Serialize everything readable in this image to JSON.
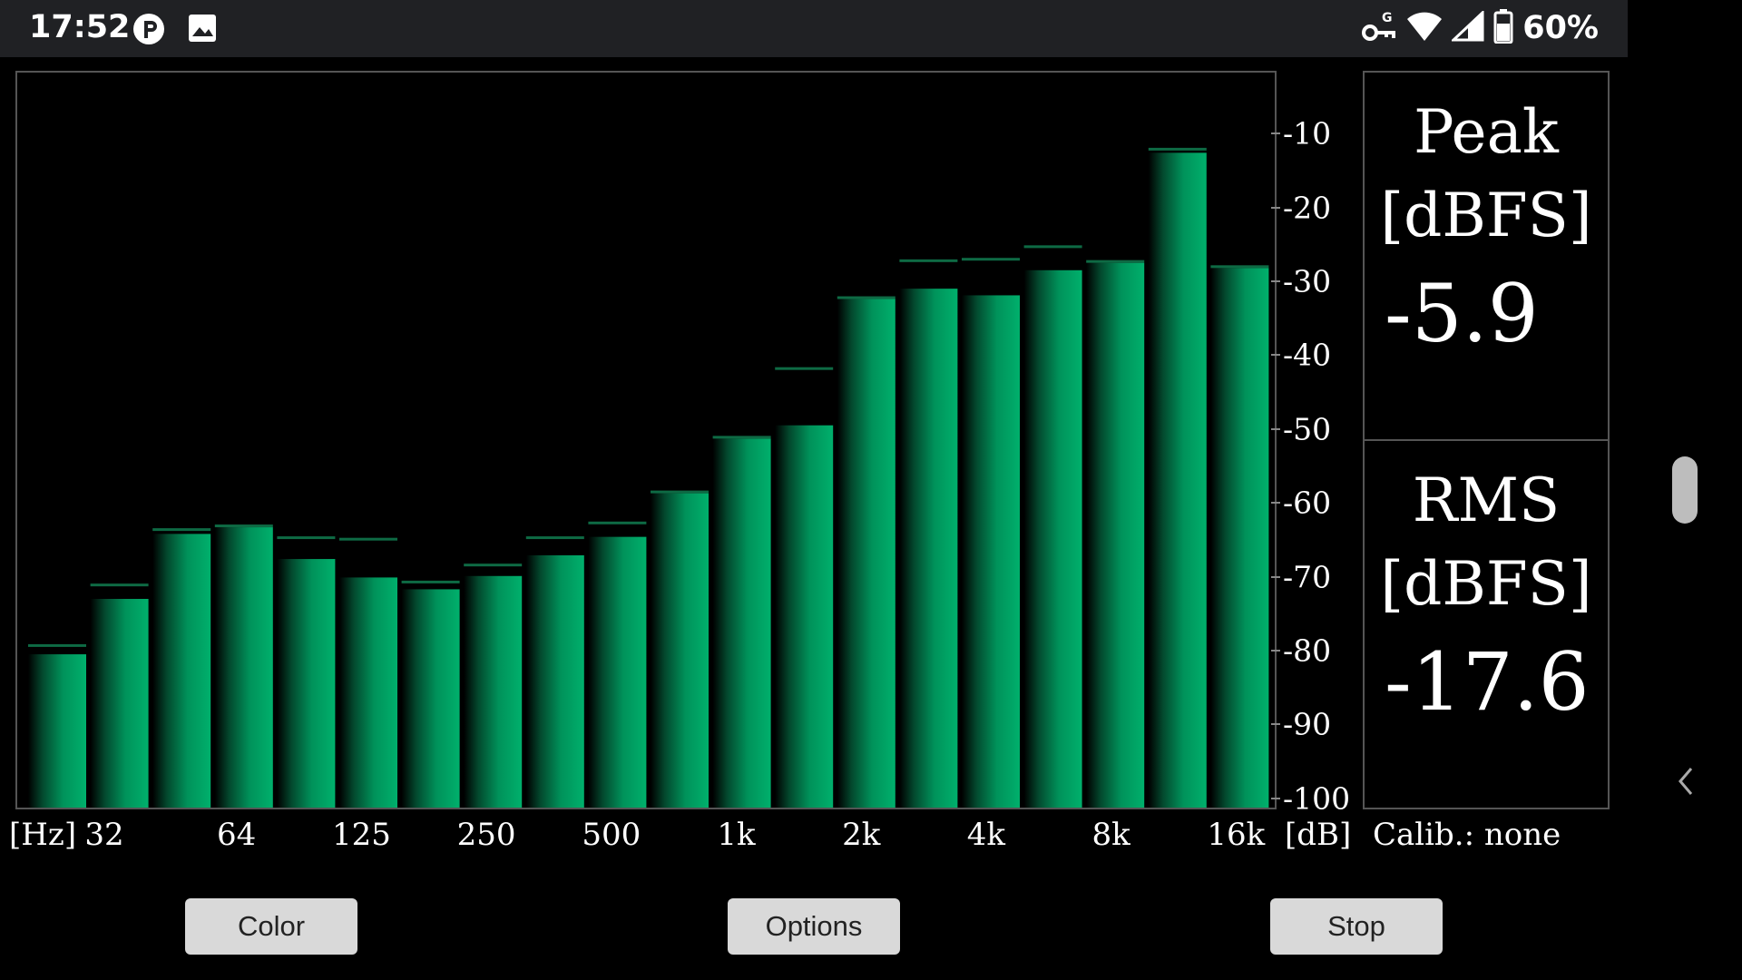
{
  "status_bar": {
    "time": "17:52",
    "battery_percent": "60%",
    "icons": [
      "pocket-casts-icon",
      "image-icon",
      "vpn-key-icon",
      "wifi-icon",
      "signal-icon",
      "battery-icon"
    ]
  },
  "chart_data": {
    "type": "bar",
    "title": "",
    "xlabel": "[Hz]",
    "ylabel": "[dB]",
    "x_tick_labels": [
      "32",
      "64",
      "125",
      "250",
      "500",
      "1k",
      "2k",
      "4k",
      "8k",
      "16k"
    ],
    "y_ticks": [
      -10,
      -20,
      -30,
      -40,
      -50,
      -60,
      -70,
      -80,
      -90,
      -100
    ],
    "ylim": [
      -101.5,
      -1.5
    ],
    "grid": false,
    "legend": "none",
    "bar_color": "#00925a",
    "peak_marker_color": "#0e6a44",
    "bands_count": 20,
    "values": [
      -80.5,
      -73.0,
      -64.2,
      -63.3,
      -67.6,
      -70.1,
      -71.7,
      -69.9,
      -67.1,
      -64.6,
      -58.7,
      -51.3,
      -49.5,
      -32.4,
      -31.0,
      -31.9,
      -28.5,
      -27.5,
      -12.6,
      -28.2
    ],
    "peak_hold": [
      -79.5,
      -71.3,
      -63.8,
      -63.3,
      -64.9,
      -65.1,
      -70.9,
      -68.6,
      -64.9,
      -62.9,
      -58.7,
      -51.3,
      -42.0,
      -32.4,
      -27.4,
      -27.2,
      -25.5,
      -27.5,
      -12.3,
      -28.2
    ]
  },
  "readouts": {
    "peak": {
      "title_line1": "Peak",
      "title_line2": "[dBFS]",
      "value": "-5.9"
    },
    "rms": {
      "title_line1": "RMS",
      "title_line2": "[dBFS]",
      "value": "-17.6"
    }
  },
  "calibration": "Calib.: none",
  "buttons": {
    "color": "Color",
    "options": "Options",
    "stop": "Stop"
  }
}
